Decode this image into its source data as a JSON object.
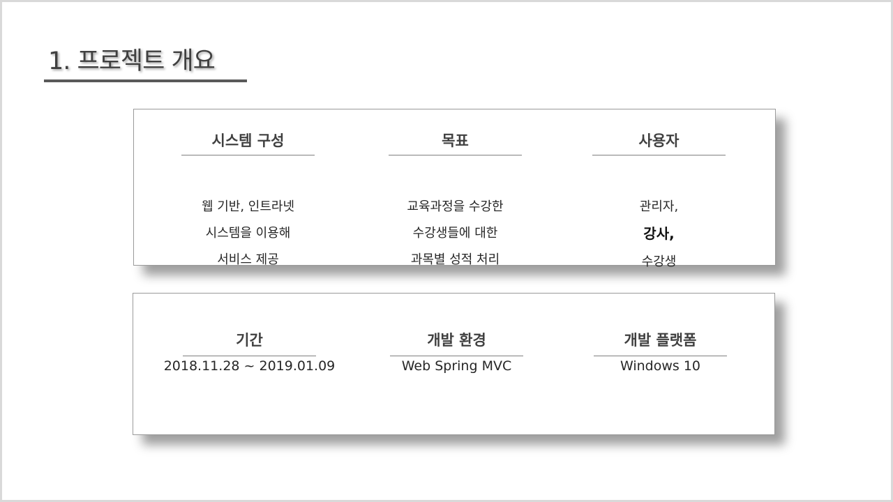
{
  "slide": {
    "title": "1. 프로젝트 개요"
  },
  "overview_card": {
    "columns": [
      {
        "heading": "시스템 구성",
        "lines": [
          "웹 기반, 인트라넷",
          "시스템을 이용해",
          "서비스 제공"
        ]
      },
      {
        "heading": "목표",
        "lines": [
          "교육과정을 수강한",
          "수강생들에 대한",
          "과목별 성적 처리"
        ]
      },
      {
        "heading": "사용자",
        "lines": [
          "관리자,",
          "강사,",
          "수강생"
        ]
      }
    ]
  },
  "details_card": {
    "columns": [
      {
        "heading": "기간",
        "value": "2018.11.28  ~ 2019.01.09"
      },
      {
        "heading": "개발 환경",
        "value": "Web Spring MVC"
      },
      {
        "heading": "개발 플랫폼",
        "value": "Windows 10"
      }
    ]
  }
}
